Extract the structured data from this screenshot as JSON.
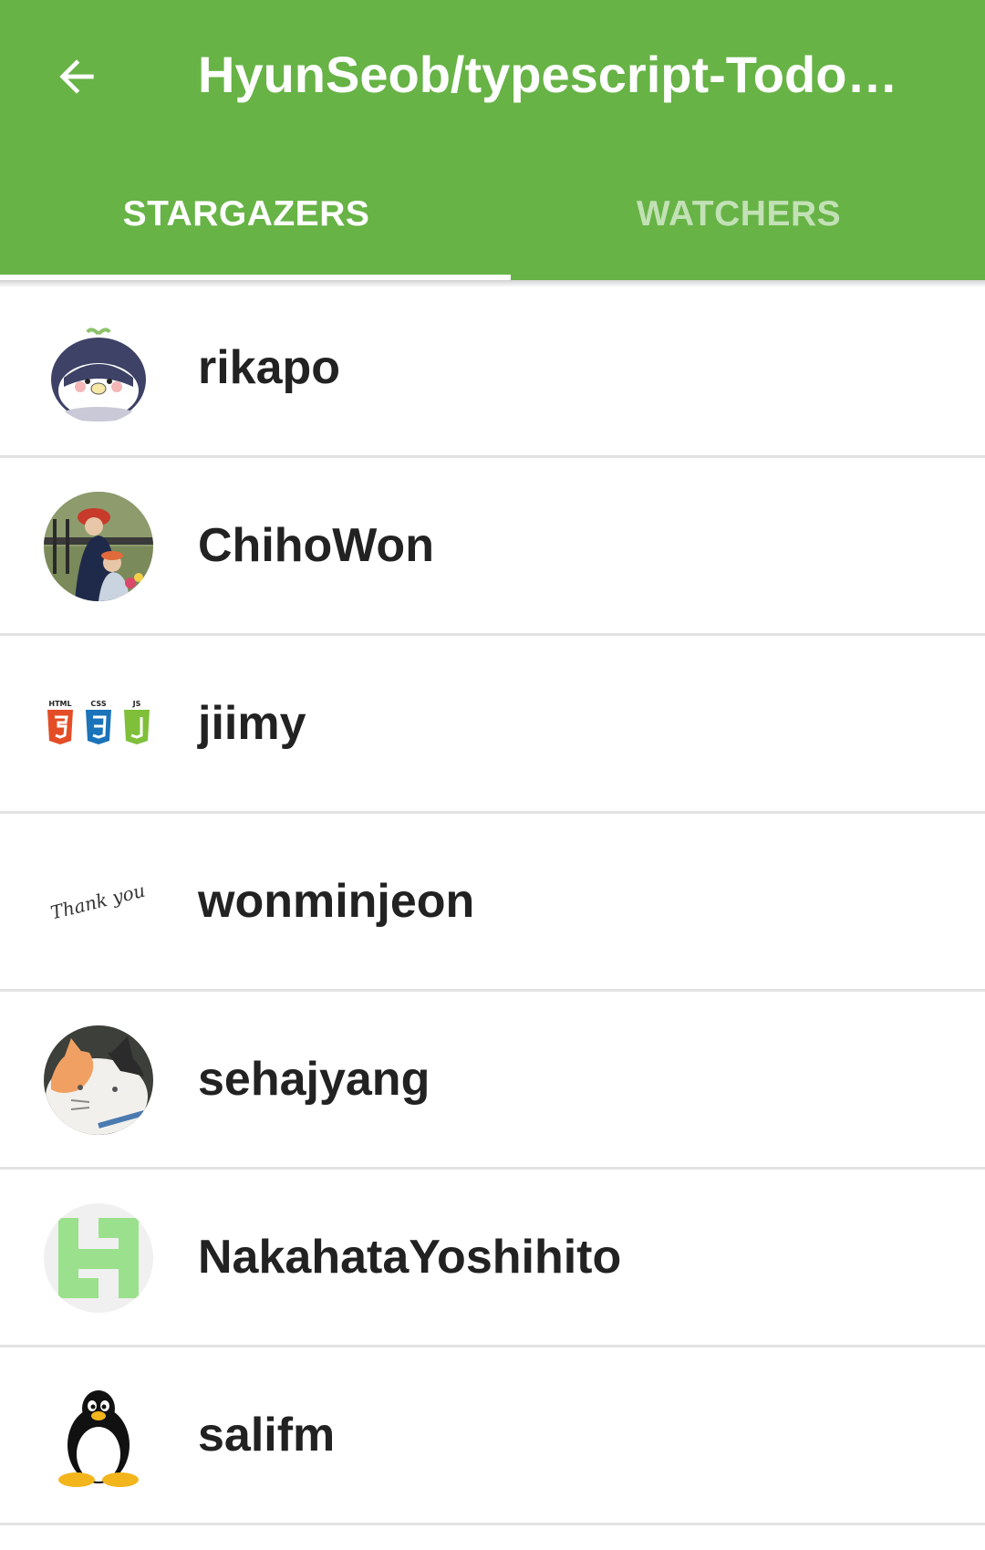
{
  "app_bar": {
    "title": "HyunSeob/typescript-TodoM…",
    "back_icon": "arrow-left-icon",
    "background": "#67b346"
  },
  "tabs": [
    {
      "label": "STARGAZERS",
      "active": true
    },
    {
      "label": "WATCHERS",
      "active": false
    }
  ],
  "users": [
    {
      "name": "rikapo",
      "avatar": "penguin-bird-avatar"
    },
    {
      "name": "ChihoWon",
      "avatar": "painting-avatar"
    },
    {
      "name": "jiimy",
      "avatar": "html-css-js-logos-avatar",
      "avatar_text": [
        "HTML",
        "CSS",
        "JS"
      ]
    },
    {
      "name": "wonminjeon",
      "avatar": "thank-you-handwriting-avatar",
      "avatar_text": "Thank you"
    },
    {
      "name": "sehajyang",
      "avatar": "calico-cat-plush-avatar"
    },
    {
      "name": "NakahataYoshihito",
      "avatar": "green-identicon-avatar"
    },
    {
      "name": "salifm",
      "avatar": "tux-penguin-avatar"
    }
  ]
}
